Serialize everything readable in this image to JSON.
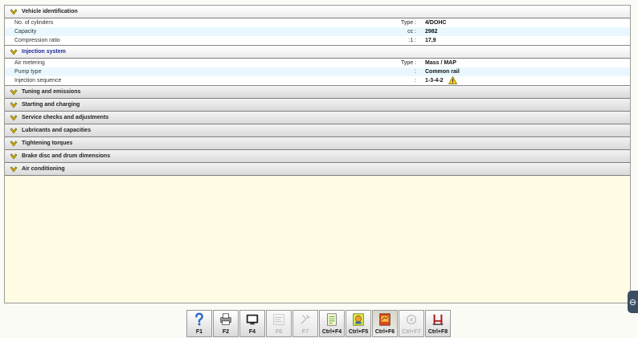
{
  "sections": [
    {
      "title": "Vehicle identification",
      "open": true,
      "style": "normal",
      "rows": [
        {
          "label": "No. of cylinders",
          "key": "Type",
          "value": "4/DOHC"
        },
        {
          "label": "Capacity",
          "key": "cc",
          "value": "2982"
        },
        {
          "label": "Compression ratio",
          "key": ":1",
          "value": "17,9"
        }
      ]
    },
    {
      "title": "Injection system",
      "open": true,
      "style": "blue",
      "rows": [
        {
          "label": "Air metering",
          "key": "Type",
          "value": "Mass / MAP"
        },
        {
          "label": "Pump type",
          "key": "",
          "value": "Common rail"
        },
        {
          "label": "Injection sequence",
          "key": "",
          "value": "1-3-4-2",
          "warning": true
        }
      ]
    },
    {
      "title": "Tuning and emissions",
      "open": false
    },
    {
      "title": "Starting and charging",
      "open": false
    },
    {
      "title": "Service checks and adjustments",
      "open": false
    },
    {
      "title": "Lubricants and capacities",
      "open": false
    },
    {
      "title": "Tightening torques",
      "open": false
    },
    {
      "title": "Brake disc and drum dimensions",
      "open": false
    },
    {
      "title": "Air conditioning",
      "open": false
    }
  ],
  "toolbar": [
    {
      "label": "F1",
      "icon": "help-icon",
      "enabled": true
    },
    {
      "label": "F2",
      "icon": "print-icon",
      "enabled": true
    },
    {
      "label": "F4",
      "icon": "monitor-icon",
      "enabled": true
    },
    {
      "label": "F6",
      "icon": "diagram-icon",
      "enabled": false
    },
    {
      "label": "F7",
      "icon": "tool-icon",
      "enabled": false
    },
    {
      "label": "Ctrl+F4",
      "icon": "notepad-icon",
      "enabled": true
    },
    {
      "label": "Ctrl+F5",
      "icon": "service-hand-icon",
      "enabled": true
    },
    {
      "label": "Ctrl+F6",
      "icon": "vehicle-book-icon",
      "enabled": true,
      "pressed": true
    },
    {
      "label": "Ctrl+F7",
      "icon": "gear-globe-icon",
      "enabled": false
    },
    {
      "label": "Ctrl+F8",
      "icon": "lift-icon",
      "enabled": true
    }
  ],
  "colors": {
    "background": "#fffce3",
    "row_alt": "#e9f8ff",
    "chevron": "#d8b400",
    "section_blue": "#1b2a9a",
    "edge_tab": "#3c4e62"
  }
}
